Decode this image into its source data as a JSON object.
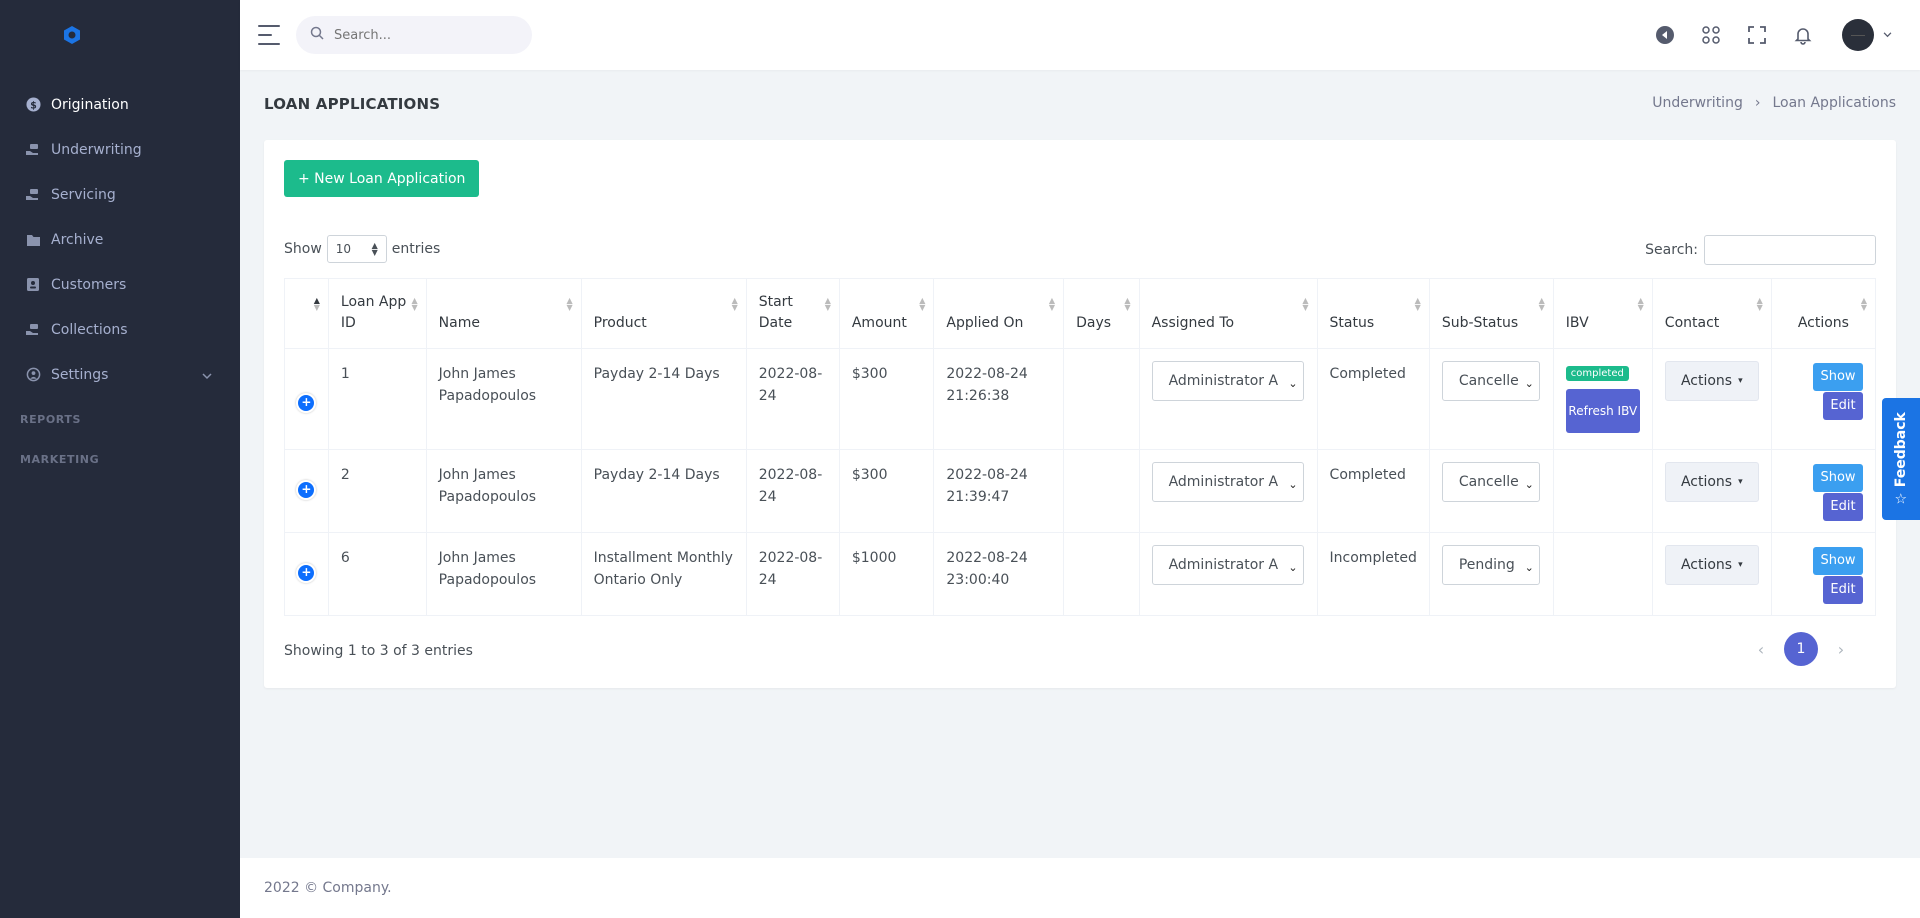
{
  "sidebar": {
    "logo_icon": "hexagon-logo-icon",
    "items": [
      {
        "label": "Origination",
        "icon": "dollar-icon",
        "active": true
      },
      {
        "label": "Underwriting",
        "icon": "hand-money-icon"
      },
      {
        "label": "Servicing",
        "icon": "hand-money-icon"
      },
      {
        "label": "Archive",
        "icon": "archive-icon"
      },
      {
        "label": "Customers",
        "icon": "contacts-icon"
      },
      {
        "label": "Collections",
        "icon": "hand-money-icon"
      },
      {
        "label": "Settings",
        "icon": "gear-icon",
        "has_submenu": true
      }
    ],
    "sections": [
      "REPORTS",
      "MARKETING"
    ]
  },
  "topbar": {
    "search_placeholder": "Search...",
    "icons": [
      "back-arrow-icon",
      "apps-grid-icon",
      "fullscreen-icon",
      "bell-icon",
      "avatar",
      "chevron-down-icon"
    ]
  },
  "page": {
    "title": "LOAN APPLICATIONS",
    "breadcrumb": [
      "Underwriting",
      "Loan Applications"
    ],
    "breadcrumb_sep": "›"
  },
  "card": {
    "new_button": "+ New Loan Application",
    "show_label": "Show",
    "entries_value": "10",
    "entries_label": "entries",
    "search_label": "Search:",
    "search_value": ""
  },
  "table": {
    "columns": [
      "",
      "Loan App ID",
      "Name",
      "Product",
      "Start Date",
      "Amount",
      "Applied On",
      "Days",
      "Assigned To",
      "Status",
      "Sub-Status",
      "IBV",
      "Contact",
      "Actions"
    ],
    "rows": [
      {
        "id": "1",
        "name": "John James Papadopoulos",
        "product": "Payday 2-14 Days",
        "start_date": "2022-08-24",
        "amount": "$300",
        "applied_on": "2022-08-24 21:26:38",
        "days": "",
        "assigned_to": "Administrator A",
        "status": "Completed",
        "sub_status": "Cancelle",
        "ibv_badge": "completed",
        "ibv_button": "Refresh IBV",
        "contact": "Actions",
        "show": "Show",
        "edit": "Edit"
      },
      {
        "id": "2",
        "name": "John James Papadopoulos",
        "product": "Payday 2-14 Days",
        "start_date": "2022-08-24",
        "amount": "$300",
        "applied_on": "2022-08-24 21:39:47",
        "days": "",
        "assigned_to": "Administrator A",
        "status": "Completed",
        "sub_status": "Cancelle",
        "ibv_badge": "",
        "ibv_button": "",
        "contact": "Actions",
        "show": "Show",
        "edit": "Edit"
      },
      {
        "id": "6",
        "name": "John James Papadopoulos",
        "product": "Installment Monthly Ontario Only",
        "start_date": "2022-08-24",
        "amount": "$1000",
        "applied_on": "2022-08-24 23:00:40",
        "days": "",
        "assigned_to": "Administrator A",
        "status": "Incompleted",
        "sub_status": "Pending",
        "ibv_badge": "",
        "ibv_button": "",
        "contact": "Actions",
        "show": "Show",
        "edit": "Edit"
      }
    ]
  },
  "pagination": {
    "info": "Showing 1 to 3 of 3 entries",
    "prev": "‹",
    "current": "1",
    "next": "›"
  },
  "footer": "2022 © Company.",
  "feedback": "Feedback",
  "colors": {
    "sidebar_bg": "#252b3b",
    "success": "#1cbb8c",
    "primary": "#5664d2",
    "info": "#3b9ff0",
    "feedback": "#1b74e4"
  }
}
